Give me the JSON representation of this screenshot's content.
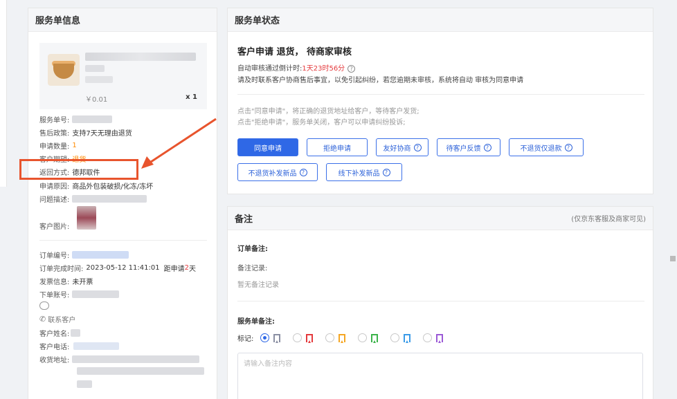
{
  "left": {
    "title": "服务单信息",
    "product": {
      "price": "￥0.01",
      "qty": "x 1"
    },
    "rows": {
      "service_no_label": "服务单号:",
      "policy_label": "售后政策:",
      "policy_value": "支持7天无理由退货",
      "apply_qty_label": "申请数量:",
      "apply_qty_value": "1",
      "expect_label": "客户期望:",
      "expect_value": "退货",
      "return_label": "返回方式:",
      "return_value": "德邦取件",
      "reason_label": "申请原因:",
      "reason_value": "商品外包装破损/化冻/冻坏",
      "desc_label": "问题描述:",
      "image_label": "客户图片:",
      "order_no_label": "订单编号:",
      "order_done_label": "订单完成时间:",
      "order_done_value": "2023-05-12 11:41:01",
      "since_apply_prefix": "距申请",
      "since_apply_days": "2",
      "since_apply_suffix": "天",
      "invoice_label": "发票信息:",
      "invoice_value": "未开票",
      "account_label": "下单账号:",
      "contact_label": "联系客户",
      "cust_name_label": "客户姓名:",
      "cust_phone_label": "客户电话:",
      "address_label": "收货地址:"
    }
  },
  "status": {
    "title": "服务单状态",
    "headline": "客户申请 退货， 待商家审核",
    "countdown_label": "自动审核通过倒计时:",
    "countdown_value": "1天23时56分",
    "notice": "请及时联系客户协商售后事宜，以免引起纠纷，若您逾期未审核，系统将自动 审核为同意申请",
    "tip1": "点击\"同意申请\"，将正确的退货地址给客户，等待客户发货;",
    "tip2": "点击\"拒绝申请\"，服务单关闭，客户可以申请纠纷投诉;",
    "buttons": {
      "agree": "同意申请",
      "reject": "拒绝申请",
      "negotiate": "友好协商",
      "wait_feedback": "待客户反馈",
      "refund_only": "不退货仅退款",
      "reissue": "不退货补发新品",
      "offline_reissue": "线下补发新品"
    }
  },
  "remark": {
    "title": "备注",
    "note": "(仅京东客服及商家可见)",
    "order_remark_label": "订单备注:",
    "record_label": "备注记录:",
    "no_record": "暂无备注记录",
    "service_remark_label": "服务单备注:",
    "tag_label": "标记:",
    "placeholder": "请输入备注内容",
    "flag_colors": [
      "#8a8fa3",
      "#e4393c",
      "#f5a623",
      "#3bb34a",
      "#3a9be8",
      "#9b59d6"
    ]
  }
}
